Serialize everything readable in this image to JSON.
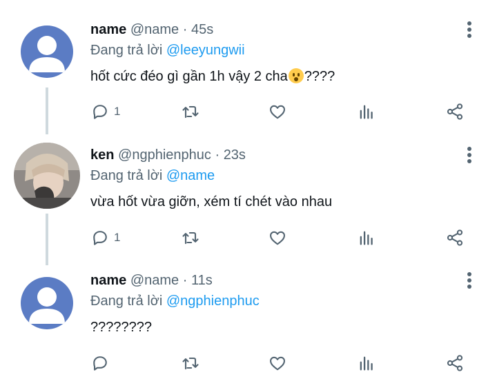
{
  "tweets": [
    {
      "display_name": "name",
      "handle": "@name",
      "separator": "·",
      "time": "45s",
      "replying_prefix": "Đang trả lời",
      "replying_to": "@leeyungwii",
      "text_before_emoji": "hốt cức đéo gì gần 1h vậy 2 cha",
      "emoji": "worried-face",
      "text_after_emoji": "????",
      "reply_count": "1",
      "avatar": "default-avatar"
    },
    {
      "display_name": "ken",
      "handle": "@ngphienphuc",
      "separator": "·",
      "time": "23s",
      "replying_prefix": "Đang trả lời",
      "replying_to": "@name",
      "text": "vừa hốt vừa giỡn, xém tí chét vào nhau",
      "reply_count": "1",
      "avatar": "photo-avatar"
    },
    {
      "display_name": "name",
      "handle": "@name",
      "separator": "·",
      "time": "11s",
      "replying_prefix": "Đang trả lời",
      "replying_to": "@ngphienphuc",
      "text": "????????",
      "reply_count": "",
      "avatar": "default-avatar"
    }
  ],
  "colors": {
    "text_primary": "#0f1419",
    "text_secondary": "#536471",
    "mention": "#1d9bf0",
    "avatar_bg": "#5b7cc4",
    "thread_line": "#cfd9de"
  }
}
